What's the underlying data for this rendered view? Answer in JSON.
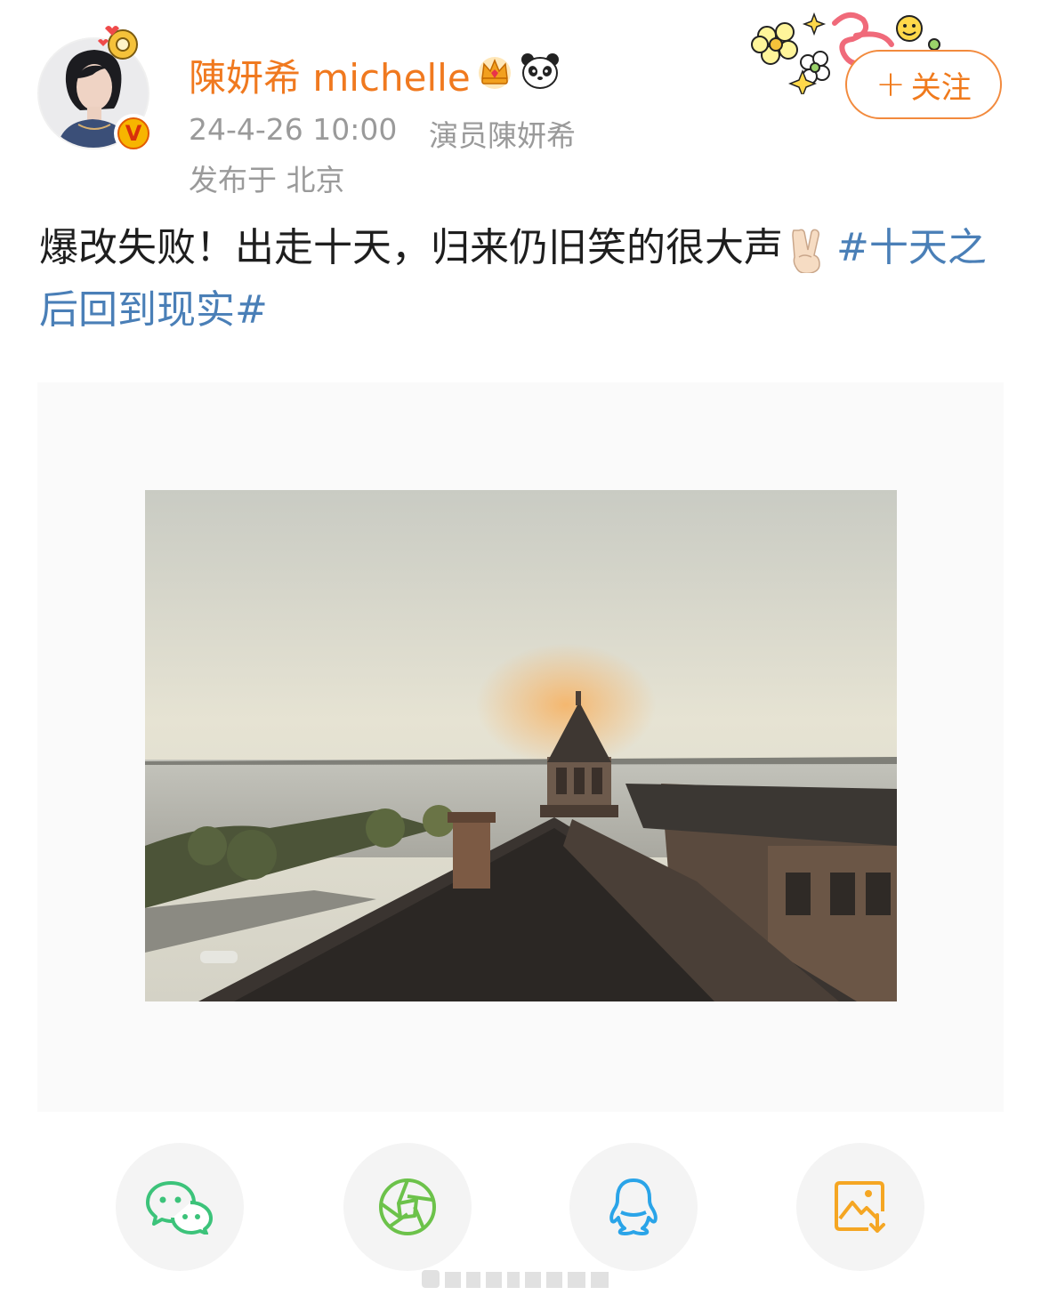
{
  "header": {
    "username": "陳妍希 michelle",
    "time": "24-4-26 10:00",
    "source": "演员陳妍希",
    "location": "发布于 北京",
    "verified_badge": "V",
    "follow_plus": "+",
    "follow_label": "关注"
  },
  "post": {
    "text": "爆改失败！出走十天，归来仍旧笑的很大声",
    "topic": "#十天之后回到现实#"
  },
  "share": {
    "wechat": "wechat-icon",
    "moments": "moments-icon",
    "qq": "qq-icon",
    "save": "save-image-icon"
  },
  "colors": {
    "username": "#f0791f",
    "meta": "#9a9a9a",
    "follow_border": "#f28a3d",
    "topic_link": "#4a7fb7",
    "wechat_green": "#3cc37a",
    "moments_green": "#6cc24a",
    "qq_blue": "#2aa4e8",
    "save_orange": "#f5a623"
  }
}
